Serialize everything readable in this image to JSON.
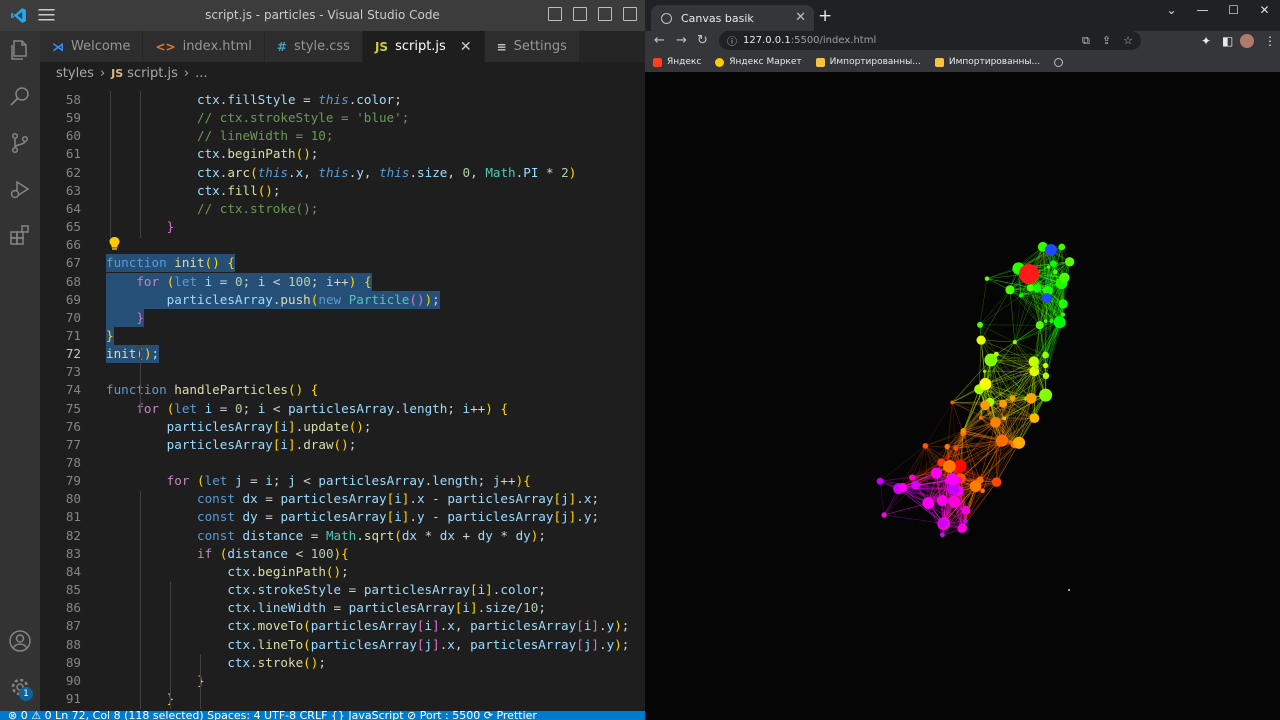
{
  "vscode": {
    "window_title": "script.js - particles - Visual Studio Code",
    "tabs": [
      {
        "label": "Welcome",
        "icon": "vscode-icon",
        "active": false
      },
      {
        "label": "index.html",
        "icon": "html-icon",
        "active": false
      },
      {
        "label": "style.css",
        "icon": "css-icon",
        "active": false
      },
      {
        "label": "script.js",
        "icon": "js-icon",
        "active": true
      },
      {
        "label": "Settings",
        "icon": "settings-list-icon",
        "active": false
      }
    ],
    "tab_icon_glyphs": [
      "⋊",
      "<>",
      "#",
      "JS",
      "≡"
    ],
    "close_glyph": "✕",
    "breadcrumb": {
      "folder": "styles",
      "file": "script.js",
      "js_badge": "JS",
      "sep": "›",
      "more": "..."
    },
    "settings_badge": "1",
    "statusbar_text": "⊗ 0 ⚠ 0   Ln 72, Col 8 (118 selected)   Spaces: 4   UTF-8   CRLF   {} JavaScript   ⊘ Port : 5500   ⟳ Prettier",
    "colors": {
      "background": "#1e1e1e",
      "selection": "#264f78",
      "statusbar": "#007acc"
    },
    "code_lines": [
      {
        "n": "58",
        "text": "            ctx.fillStyle = this.color;"
      },
      {
        "n": "59",
        "text": "            // ctx.strokeStyle = 'blue';"
      },
      {
        "n": "60",
        "text": "            // lineWidth = 10;"
      },
      {
        "n": "61",
        "text": "            ctx.beginPath();"
      },
      {
        "n": "62",
        "text": "            ctx.arc(this.x, this.y, this.size, 0, Math.PI * 2)"
      },
      {
        "n": "63",
        "text": "            ctx.fill();"
      },
      {
        "n": "64",
        "text": "            // ctx.stroke();"
      },
      {
        "n": "65",
        "text": "        }"
      },
      {
        "n": "66",
        "text": ""
      },
      {
        "n": "67",
        "text": "function init() {"
      },
      {
        "n": "68",
        "text": "    for (let i = 0; i < 100; i++) {"
      },
      {
        "n": "69",
        "text": "        particlesArray.push(new Particle());"
      },
      {
        "n": "70",
        "text": "    }"
      },
      {
        "n": "71",
        "text": "}"
      },
      {
        "n": "72",
        "text": "init();"
      },
      {
        "n": "73",
        "text": ""
      },
      {
        "n": "74",
        "text": "function handleParticles() {"
      },
      {
        "n": "75",
        "text": "    for (let i = 0; i < particlesArray.length; i++) {"
      },
      {
        "n": "76",
        "text": "        particlesArray[i].update();"
      },
      {
        "n": "77",
        "text": "        particlesArray[i].draw();"
      },
      {
        "n": "78",
        "text": ""
      },
      {
        "n": "79",
        "text": "        for (let j = i; j < particlesArray.length; j++){"
      },
      {
        "n": "80",
        "text": "            const dx = particlesArray[i].x - particlesArray[j].x;"
      },
      {
        "n": "81",
        "text": "            const dy = particlesArray[i].y - particlesArray[j].y;"
      },
      {
        "n": "82",
        "text": "            const distance = Math.sqrt(dx * dx + dy * dy);"
      },
      {
        "n": "83",
        "text": "            if (distance < 100){"
      },
      {
        "n": "84",
        "text": "                ctx.beginPath();"
      },
      {
        "n": "85",
        "text": "                ctx.strokeStyle = particlesArray[i].color;"
      },
      {
        "n": "86",
        "text": "                ctx.lineWidth = particlesArray[i].size/10;"
      },
      {
        "n": "87",
        "text": "                ctx.moveTo(particlesArray[i].x, particlesArray[i].y);"
      },
      {
        "n": "88",
        "text": "                ctx.lineTo(particlesArray[j].x, particlesArray[j].y);"
      },
      {
        "n": "89",
        "text": "                ctx.stroke();"
      },
      {
        "n": "90",
        "text": "            }"
      },
      {
        "n": "91",
        "text": "        }"
      }
    ],
    "selected_lines": [
      "67",
      "68",
      "69",
      "70",
      "71",
      "72"
    ],
    "current_line": "72"
  },
  "chrome": {
    "tab_title": "Canvas basik",
    "tab_close": "✕",
    "new_tab": "+",
    "win_controls": [
      "⌄",
      "—",
      "☐",
      "✕"
    ],
    "url_host": "127.0.0.1",
    "url_path": ":5500/index.html",
    "nav": {
      "back": "←",
      "forward": "→",
      "reload": "↻",
      "info": "ⓘ"
    },
    "omnibox_icons": [
      "⧉",
      "⇪",
      "☆"
    ],
    "ext_icons": [
      "✦",
      "◧"
    ],
    "more_menu": "⋮",
    "bookmarks": [
      {
        "label": "Яндекс",
        "color": "#fc3f1d"
      },
      {
        "label": "Яндекс Маркет",
        "color": "#ffcc00"
      },
      {
        "label": "Импортированны...",
        "color": "#f6c343"
      },
      {
        "label": "Импортированны...",
        "color": "#f6c343"
      }
    ],
    "canvas_background": "#050505"
  }
}
